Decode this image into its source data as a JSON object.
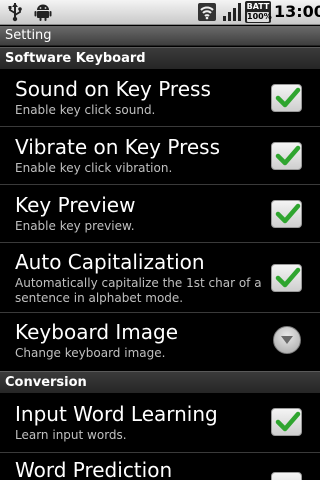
{
  "status_bar": {
    "icons": [
      "usb-icon",
      "android-debug-icon",
      "wifi-icon",
      "signal-icon"
    ],
    "battery_label": "BATT",
    "battery_percent": "100%",
    "time": "13:00"
  },
  "title_bar": {
    "title": "Setting"
  },
  "sections": {
    "software_keyboard": "Software Keyboard",
    "conversion": "Conversion"
  },
  "prefs": {
    "sound": {
      "title": "Sound on Key Press",
      "summary": "Enable key click sound.",
      "checked": true
    },
    "vibrate": {
      "title": "Vibrate on Key Press",
      "summary": "Enable key click vibration.",
      "checked": true
    },
    "preview": {
      "title": "Key Preview",
      "summary": "Enable key preview.",
      "checked": true
    },
    "autocap": {
      "title": "Auto Capitalization",
      "summary": "Automatically capitalize the 1st char of a sentence in alphabet mode.",
      "checked": true
    },
    "keyboard_image": {
      "title": "Keyboard Image",
      "summary": "Change keyboard image.",
      "icon": "dropdown-arrow-icon"
    },
    "word_learning": {
      "title": "Input Word Learning",
      "summary": "Learn input words.",
      "checked": true
    },
    "word_prediction": {
      "title": "Word Prediction"
    }
  },
  "colors": {
    "check_green": "#2fa52f",
    "background": "#000000",
    "summary_text": "#c0c0c0"
  }
}
